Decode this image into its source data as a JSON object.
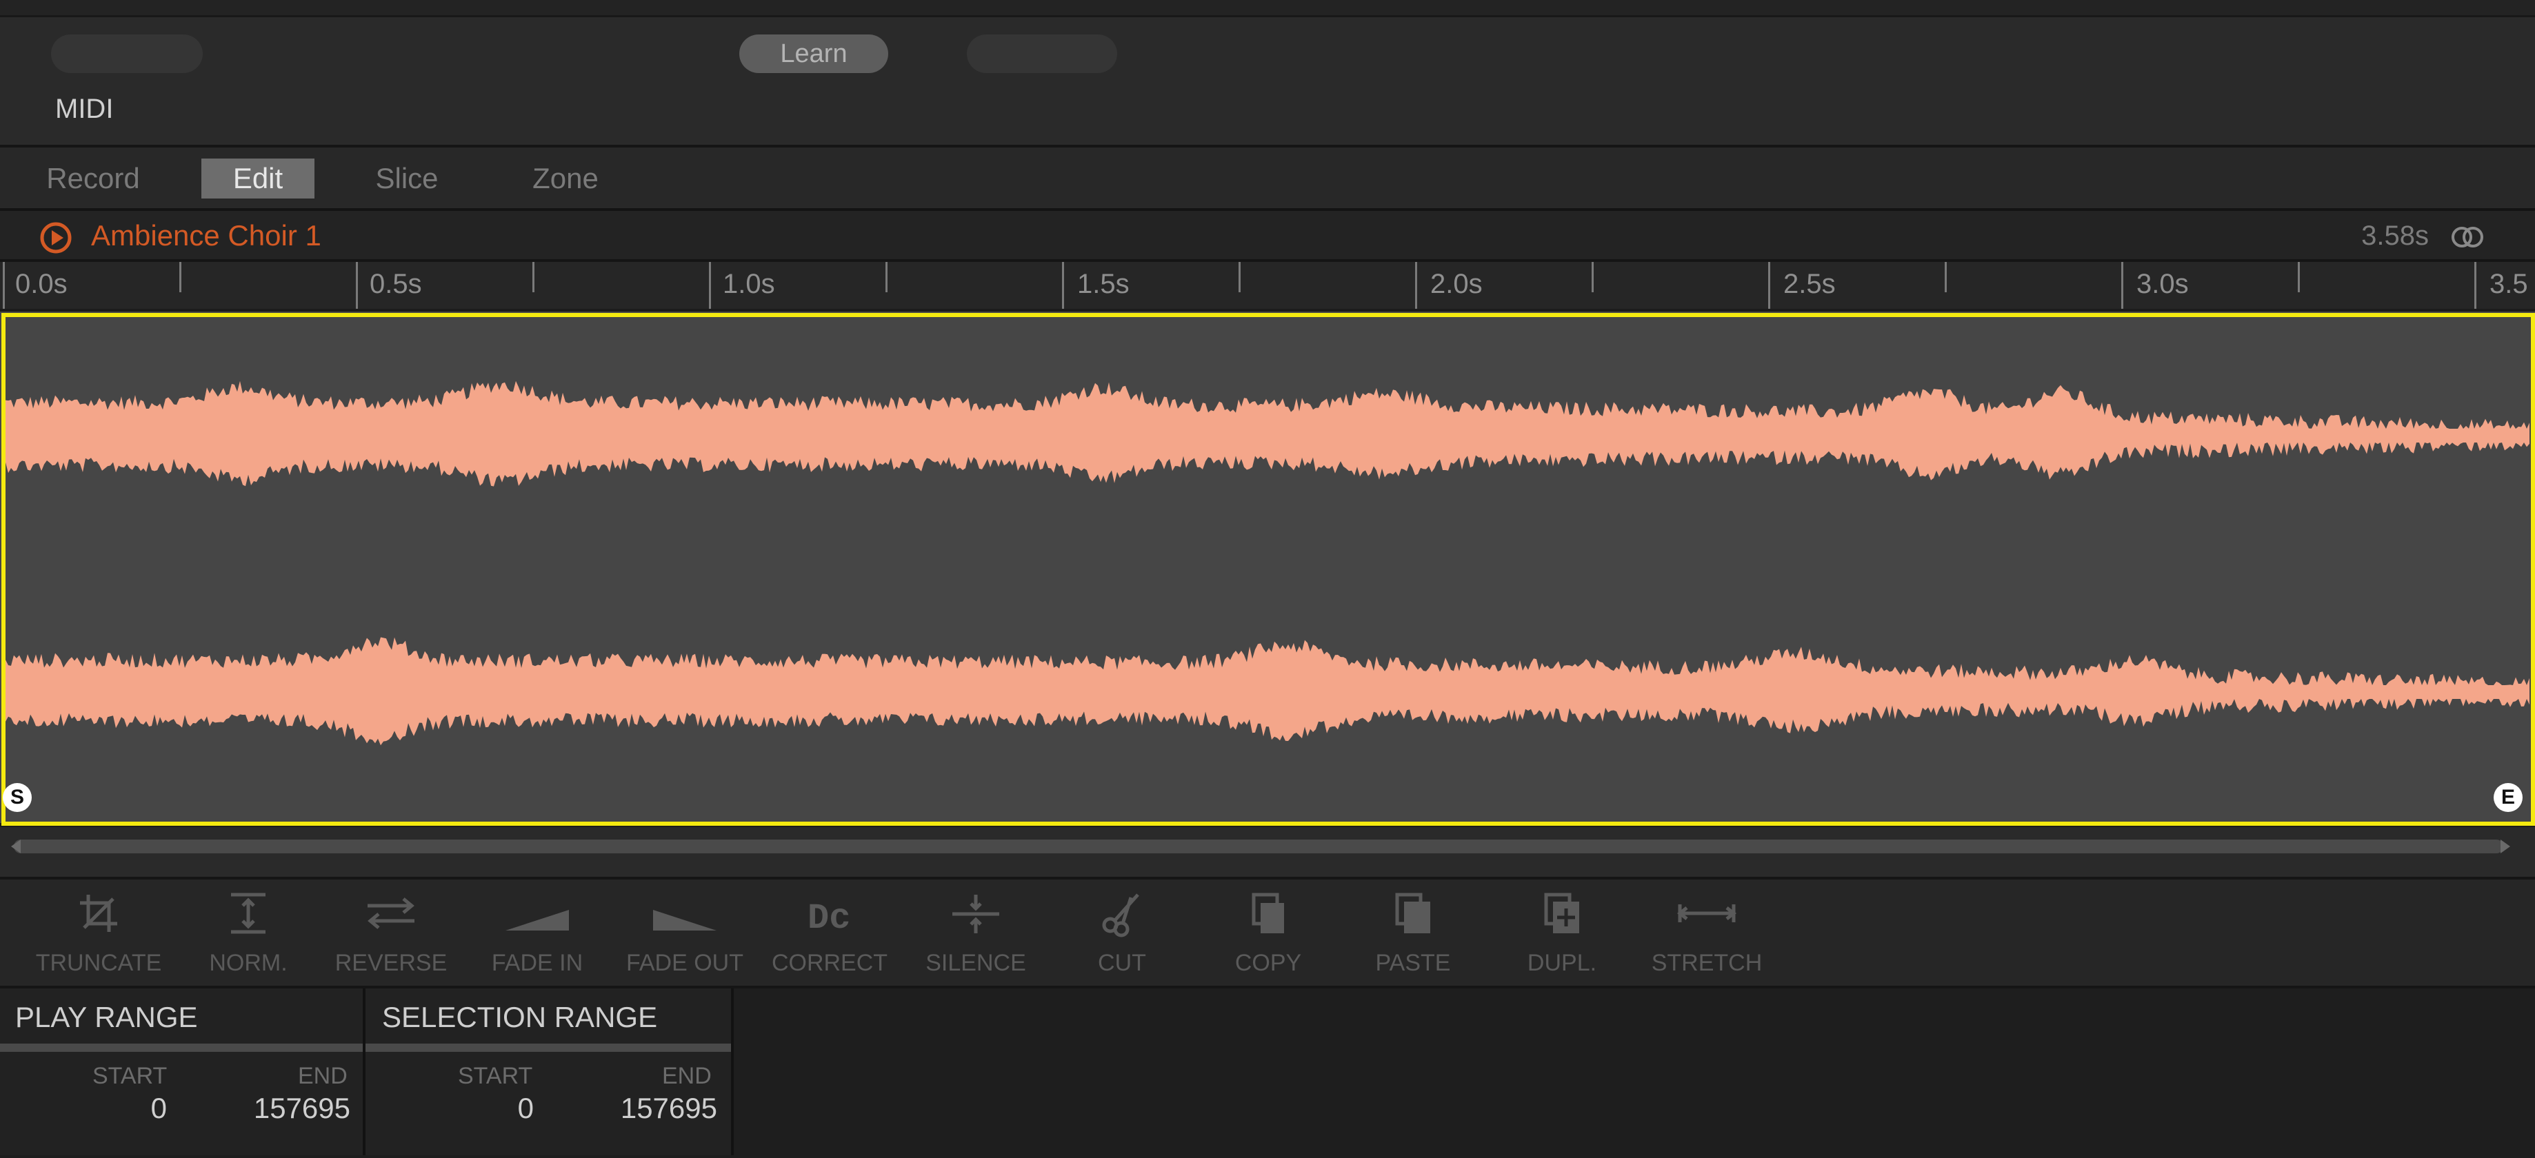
{
  "midi": {
    "learn_label": "Learn",
    "section_label": "MIDI"
  },
  "tabs": [
    {
      "label": "Record",
      "active": false
    },
    {
      "label": "Edit",
      "active": true
    },
    {
      "label": "Slice",
      "active": false
    },
    {
      "label": "Zone",
      "active": false
    }
  ],
  "sample": {
    "name": "Ambience Choir 1",
    "length": "3.58s",
    "play_icon": "play-icon",
    "link_icon": "stereo-link-icon"
  },
  "timeline": {
    "labels": [
      "0.0s",
      "0.5s",
      "1.0s",
      "1.5s",
      "2.0s",
      "2.5s",
      "3.0s",
      "3.5"
    ]
  },
  "waveform": {
    "color": "#f4a68a",
    "highlight_color": "#f5ea10",
    "start_marker": "S",
    "end_marker": "E",
    "channels": 2,
    "duration_s": 3.58
  },
  "tools": [
    {
      "label": "TRUNCATE",
      "icon": "truncate-icon"
    },
    {
      "label": "NORM.",
      "icon": "normalize-icon"
    },
    {
      "label": "REVERSE",
      "icon": "reverse-icon"
    },
    {
      "label": "FADE IN",
      "icon": "fade-in-icon"
    },
    {
      "label": "FADE OUT",
      "icon": "fade-out-icon"
    },
    {
      "label": "CORRECT",
      "icon": "dc-correct-icon"
    },
    {
      "label": "SILENCE",
      "icon": "silence-icon"
    },
    {
      "label": "CUT",
      "icon": "scissors-icon"
    },
    {
      "label": "COPY",
      "icon": "copy-icon"
    },
    {
      "label": "PASTE",
      "icon": "paste-icon"
    },
    {
      "label": "DUPL.",
      "icon": "duplicate-icon"
    },
    {
      "label": "STRETCH",
      "icon": "stretch-icon"
    }
  ],
  "play_range": {
    "title": "PLAY RANGE",
    "start_label": "START",
    "end_label": "END",
    "start": "0",
    "end": "157695"
  },
  "selection_range": {
    "title": "SELECTION RANGE",
    "start_label": "START",
    "end_label": "END",
    "start": "0",
    "end": "157695"
  }
}
